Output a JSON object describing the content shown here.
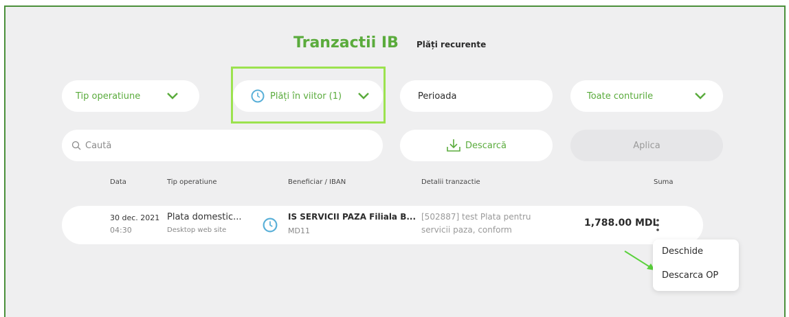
{
  "tabs": {
    "active": "Tranzactii IB",
    "secondary": "Plăți recurente"
  },
  "filters": {
    "operation_type": "Tip operatiune",
    "future_payments": "Plăți în viitor (1)",
    "period": "Perioada",
    "accounts": "Toate conturile"
  },
  "search": {
    "placeholder": "Caută"
  },
  "actions": {
    "download": "Descarcă",
    "apply": "Aplica"
  },
  "table": {
    "headers": [
      "Data",
      "Tip operatiune",
      "Beneficiar / IBAN",
      "Detalii tranzactie",
      "Suma"
    ],
    "rows": [
      {
        "date": "30 dec. 2021",
        "time": "04:30",
        "type": "Plata domestic...",
        "channel": "Desktop web site",
        "beneficiary": "IS SERVICII PAZA Filiala B...",
        "iban": "MD11",
        "details_line1": "[502887] test Plata pentru",
        "details_line2": "servicii paza, conform",
        "amount": "1,788.00 MDL"
      }
    ]
  },
  "context_menu": {
    "items": [
      "Deschide",
      "Descarca OP"
    ]
  },
  "colors": {
    "accent": "#5aab3c",
    "highlight": "#9be24e",
    "background": "#efeff0"
  }
}
